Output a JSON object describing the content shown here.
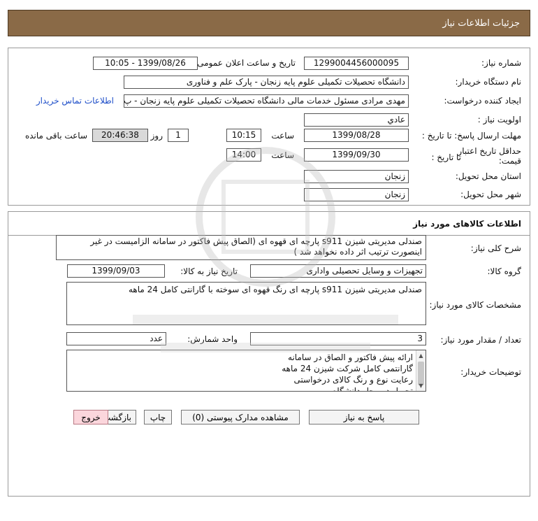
{
  "header": {
    "title": "جزئیات اطلاعات نیاز"
  },
  "need_info": {
    "need_number_label": "شماره نیاز:",
    "need_number": "1299004456000095",
    "announce_label": "تاریخ و ساعت اعلان عمومی:",
    "announce_value": "1399/08/26 - 10:05",
    "buyer_org_label": "نام دستگاه خریدار:",
    "buyer_org": "دانشگاه تحصیلات تکمیلی علوم پایه زنجان - پارک علم و فناوری",
    "requester_label": "ایجاد کننده درخواست:",
    "requester": "مهدی مرادی مسئول خدمات مالی دانشگاه تحصیلات تکمیلی علوم پایه زنجان - پ",
    "contact_link": "اطلاعات تماس خریدار",
    "priority_label": "اولویت نیاز :",
    "priority": "عادي",
    "send_deadline_label": "مهلت ارسال پاسخ: تا تاریخ :",
    "send_date": "1399/08/28",
    "time_label": "ساعت",
    "send_time": "10:15",
    "days_value": "1",
    "days_label": "روز و",
    "remaining_time": "20:46:38",
    "remaining_label": "ساعت باقی مانده",
    "validity_label_line1": "حداقل تاریخ اعتبار",
    "validity_label_line2": "قیمت:",
    "validity_to_label": "تا تاریخ :",
    "validity_date": "1399/09/30",
    "validity_time": "14:00",
    "province_label": "استان محل تحویل:",
    "province": "زنجان",
    "city_label": "شهر محل تحویل:",
    "city": "زنجان"
  },
  "goods": {
    "section_title": "اطلاعات کالاهای مورد نیاز",
    "summary_label": "شرح کلی نیاز:",
    "summary_line1": "صندلی مدیریتی شیزن s911  پارچه ای قهوه ای (الصاق پیش فاکتور در سامانه الزامیست در غیر",
    "summary_line2": "اینصورت ترتیب اثر داده نخواهد شد )",
    "group_label": "گروه کالا:",
    "group": "تجهیزات و وسایل تحصیلی واداری",
    "need_date_label": "تاریخ نیاز به کالا:",
    "need_date": "1399/09/03",
    "spec_label": "مشخصات کالای مورد نیاز:",
    "spec": "صندلی مدیریتی شیزن s911 پارچه ای رنگ قهوه ای سوخته با گارانتی کامل 24 ماهه",
    "qty_label": "تعداد / مقدار مورد نیاز:",
    "qty": "3",
    "unit_label": "واحد شمارش:",
    "unit": "عدد",
    "notes_label": "توضیحات خریدار:",
    "notes": [
      "ارائه پیش فاکتور و الصاق در سامانه",
      "گارانتمی کامل شرکت شیزن 24 ماهه",
      "رعایت نوع و رنگ کالای درخواستی",
      "تحویل در محل دانشگاه"
    ]
  },
  "buttons": {
    "reply": "پاسخ به نیاز",
    "attachments": "مشاهده مدارک پیوستی (0)",
    "print": "چاپ",
    "back": "بازگشت",
    "exit": "خروج"
  },
  "colors": {
    "header_bg": "#8a6a47",
    "link": "#1f4fc9",
    "remaining_bg": "#d9d9d9",
    "exit_bg": "#fbd6dc"
  }
}
